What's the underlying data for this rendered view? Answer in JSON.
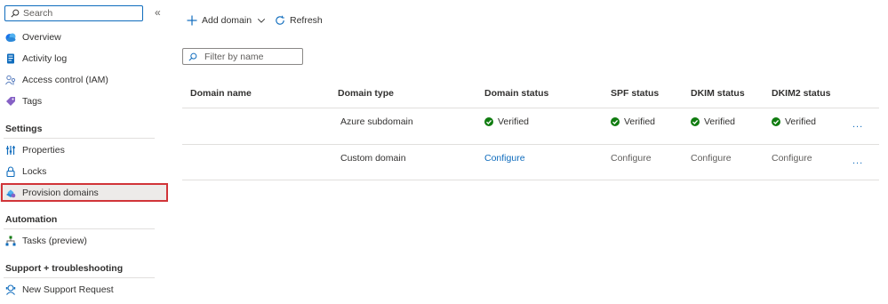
{
  "sidebar": {
    "search_placeholder": "Search",
    "collapse_glyph": "«",
    "items_top": [
      {
        "label": "Overview",
        "icon": "overview-icon"
      },
      {
        "label": "Activity log",
        "icon": "activity-log-icon"
      },
      {
        "label": "Access control (IAM)",
        "icon": "access-control-icon"
      },
      {
        "label": "Tags",
        "icon": "tag-icon"
      }
    ],
    "sections": [
      {
        "title": "Settings",
        "items": [
          {
            "label": "Properties",
            "icon": "properties-icon"
          },
          {
            "label": "Locks",
            "icon": "lock-icon"
          },
          {
            "label": "Provision domains",
            "icon": "provision-domains-icon",
            "selected": true
          }
        ]
      },
      {
        "title": "Automation",
        "items": [
          {
            "label": "Tasks (preview)",
            "icon": "tasks-icon"
          }
        ]
      },
      {
        "title": "Support + troubleshooting",
        "items": [
          {
            "label": "New Support Request",
            "icon": "support-icon"
          }
        ]
      }
    ]
  },
  "toolbar": {
    "add_domain_label": "Add domain",
    "refresh_label": "Refresh"
  },
  "filter": {
    "placeholder": "Filter by name"
  },
  "table": {
    "columns": [
      "Domain name",
      "Domain type",
      "Domain status",
      "SPF status",
      "DKIM status",
      "DKIM2 status"
    ],
    "rows": [
      {
        "domain_name": "",
        "domain_type": "Azure subdomain",
        "domain_status": "Verified",
        "spf_status": "Verified",
        "dkim_status": "Verified",
        "dkim2_status": "Verified",
        "more": "..."
      },
      {
        "domain_name": "",
        "domain_type": "Custom domain",
        "domain_status": "Configure",
        "spf_status": "Configure",
        "dkim_status": "Configure",
        "dkim2_status": "Configure",
        "more": "..."
      }
    ]
  },
  "colors": {
    "accent": "#0f6cbd",
    "success": "#107c10",
    "selection_outline": "#d13438",
    "selected_bg": "#edebe9"
  }
}
